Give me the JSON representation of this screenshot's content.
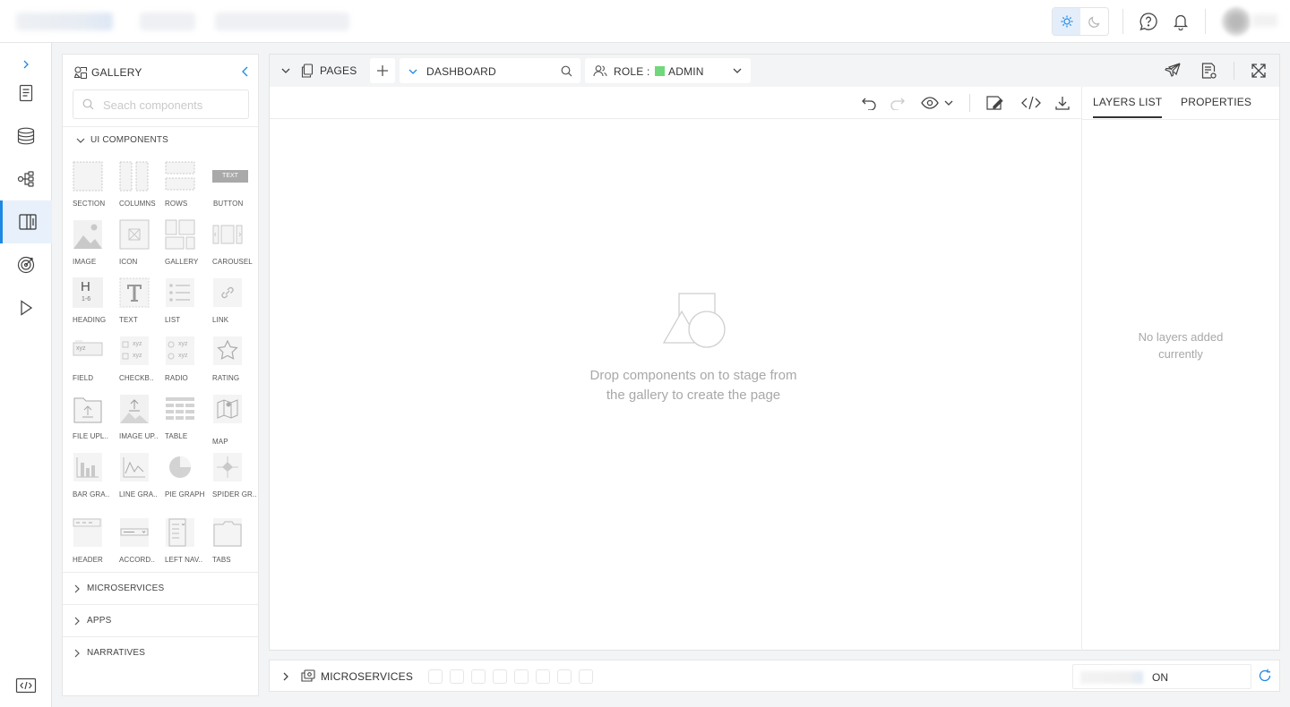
{
  "header": {
    "theme_light": "sun-icon",
    "theme_dark": "moon-icon",
    "help": "help-bubble-icon",
    "notifications": "bell-icon"
  },
  "rail": {
    "items": [
      "expand-chevron-icon",
      "document-icon",
      "database-icon",
      "workflow-icon",
      "page-builder-icon",
      "target-icon",
      "play-icon",
      "code-icon"
    ],
    "active": "page-builder-icon"
  },
  "gallery": {
    "title": "GALLERY",
    "search_placeholder": "Seach components",
    "ui_components_label": "UI COMPONENTS",
    "components": [
      {
        "label": "SECTION"
      },
      {
        "label": "COLUMNS"
      },
      {
        "label": "ROWS"
      },
      {
        "label": "BUTTON"
      },
      {
        "label": "IMAGE"
      },
      {
        "label": "ICON"
      },
      {
        "label": "GALLERY"
      },
      {
        "label": "CAROUSEL"
      },
      {
        "label": "HEADING"
      },
      {
        "label": "TEXT"
      },
      {
        "label": "LIST"
      },
      {
        "label": "LINK"
      },
      {
        "label": "FIELD"
      },
      {
        "label": "CHECKB.."
      },
      {
        "label": "RADIO"
      },
      {
        "label": "RATING"
      },
      {
        "label": "FILE UPL.."
      },
      {
        "label": "IMAGE UP.."
      },
      {
        "label": "TABLE"
      },
      {
        "label": "MAP"
      },
      {
        "label": "BAR GRA.."
      },
      {
        "label": "LINE GRA.."
      },
      {
        "label": "PIE GRAPH"
      },
      {
        "label": "SPIDER GR.."
      },
      {
        "label": "HEADER"
      },
      {
        "label": "ACCORD.."
      },
      {
        "label": "LEFT NAV.."
      },
      {
        "label": "TABS"
      }
    ],
    "button_icon_text": "TEXT",
    "heading_icon_h": "H",
    "heading_icon_sub": "1-6",
    "field_icon_text": "xyz",
    "sections": [
      {
        "label": "MICROSERVICES"
      },
      {
        "label": "APPS"
      },
      {
        "label": "NARRATIVES"
      }
    ]
  },
  "editor": {
    "pages_label": "PAGES",
    "page_name": "DASHBOARD",
    "role_label": "ROLE :",
    "role_value": "ADMIN",
    "role_color": "#6fd87a",
    "empty_stage": "Drop components on to stage from the gallery to create the page",
    "tabs": [
      {
        "label": "LAYERS LIST"
      },
      {
        "label": "PROPERTIES"
      }
    ],
    "layers_empty": "No layers added currently"
  },
  "bottom": {
    "label": "MICROSERVICES",
    "status": "ON"
  }
}
